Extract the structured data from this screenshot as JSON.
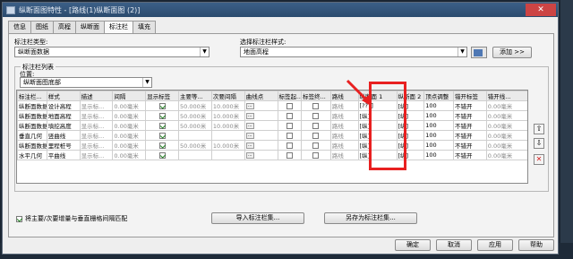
{
  "window": {
    "title": "纵断面图特性 - [路线(1)纵断面图 (2)]"
  },
  "tabs": [
    "信息",
    "图纸",
    "高程",
    "纵断面",
    "标注栏",
    "填充"
  ],
  "active_tab": "标注栏",
  "fields": {
    "band_type_label": "标注栏类型:",
    "band_type_value": "纵断面数据",
    "band_style_label": "选择标注栏样式:",
    "band_style_value": "地面高程",
    "add_button": "添加 >>",
    "list_group_label": "标注栏列表",
    "position_label": "位置:",
    "position_value": "纵断面图底部"
  },
  "table": {
    "headers": [
      "标注栏...",
      "样式",
      "描述",
      "间隔",
      "显示标签",
      "主要等...",
      "次要间隔",
      "曲线点",
      "标签起...",
      "标签终...",
      "路线",
      "纵断面 1",
      "纵断面 2",
      "顶点调整",
      "错开标签",
      "错开线..."
    ],
    "rows": [
      [
        "纵断面数据",
        "设计高程",
        "显示标...",
        "0.00毫米",
        "on",
        "50.000米",
        "10.000米",
        "...",
        "off",
        "off",
        "路线",
        "[???]",
        "[纵]",
        "100",
        "不错开",
        "0.00毫米"
      ],
      [
        "纵断面数据",
        "地面高程",
        "显示标...",
        "0.00毫米",
        "on",
        "50.000米",
        "10.000米",
        "...",
        "off",
        "off",
        "路线",
        "[纵]",
        "[纵]",
        "100",
        "不错开",
        "0.00毫米"
      ],
      [
        "纵断面数据",
        "填挖高度",
        "显示标...",
        "0.00毫米",
        "on",
        "50.000米",
        "10.000米",
        "...",
        "off",
        "off",
        "路线",
        "[纵]",
        "[纵]",
        "100",
        "不错开",
        "0.00毫米"
      ],
      [
        "垂直几何",
        "竖曲线",
        "显示标...",
        "0.00毫米",
        "on",
        "",
        "",
        "...",
        "off",
        "off",
        "路线",
        "[纵]",
        "[纵]",
        "100",
        "不错开",
        "0.00毫米"
      ],
      [
        "纵断面数据",
        "里程桩号",
        "显示标...",
        "0.00毫米",
        "on",
        "50.000米",
        "10.000米",
        "...",
        "off",
        "off",
        "路线",
        "[纵]",
        "[纵]",
        "100",
        "不错开",
        "0.00毫米"
      ],
      [
        "水平几何",
        "平曲线",
        "显示标...",
        "0.00毫米",
        "on",
        "",
        "",
        "...",
        "off",
        "off",
        "路线",
        "[纵]",
        "[纵]",
        "100",
        "不错开",
        "0.00毫米"
      ]
    ]
  },
  "bottom": {
    "match_checkbox_label": "将主要/次要增量与垂直栅格间隔匹配",
    "import_button": "导入标注栏集...",
    "saveas_button": "另存为标注栏集...",
    "ok": "确定",
    "cancel": "取消",
    "apply": "应用",
    "help": "帮助"
  },
  "icons": [
    "app-icon",
    "close-icon",
    "move-up-icon",
    "move-down-icon",
    "delete-icon",
    "arrow-annotation"
  ],
  "colors": {
    "highlight": "#e82020",
    "titlebar": "#2b4b6e"
  }
}
